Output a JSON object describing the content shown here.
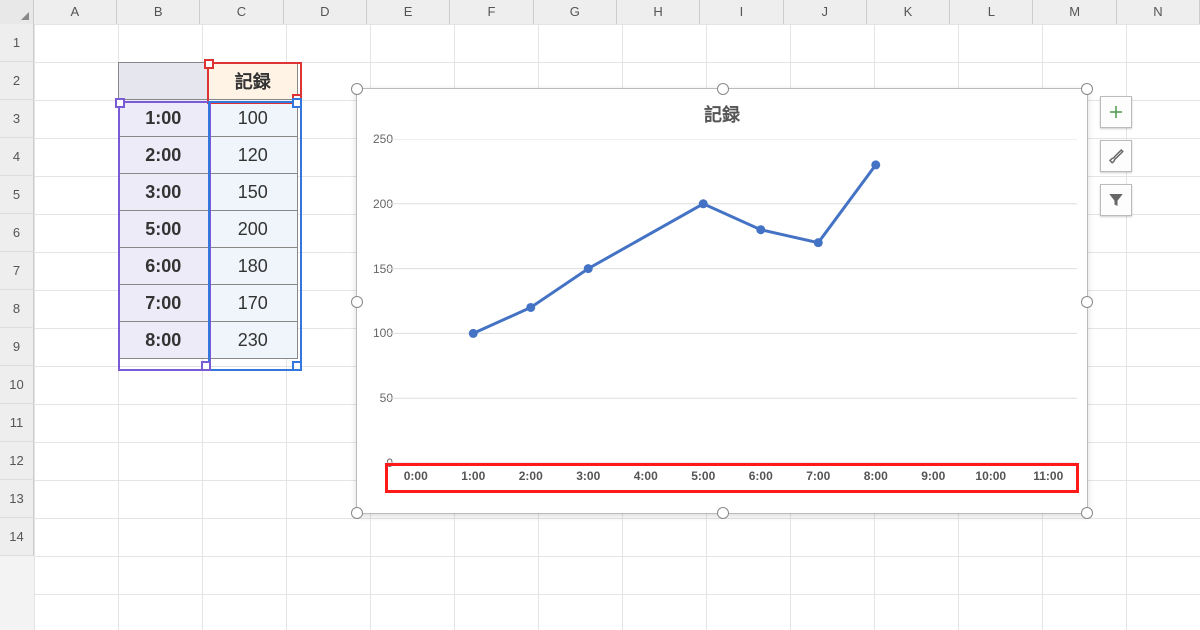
{
  "columns": [
    "A",
    "B",
    "C",
    "D",
    "E",
    "F",
    "G",
    "H",
    "I",
    "J",
    "K",
    "L",
    "M",
    "N"
  ],
  "rows": [
    "1",
    "2",
    "3",
    "4",
    "5",
    "6",
    "7",
    "8",
    "9",
    "10",
    "11",
    "12",
    "13",
    "14"
  ],
  "table": {
    "header_empty": "",
    "header_value": "記録",
    "rows": [
      {
        "time": "1:00",
        "value": "100"
      },
      {
        "time": "2:00",
        "value": "120"
      },
      {
        "time": "3:00",
        "value": "150"
      },
      {
        "time": "5:00",
        "value": "200"
      },
      {
        "time": "6:00",
        "value": "180"
      },
      {
        "time": "7:00",
        "value": "170"
      },
      {
        "time": "8:00",
        "value": "230"
      }
    ]
  },
  "chart": {
    "title": "記録",
    "x_ticks": [
      "0:00",
      "1:00",
      "2:00",
      "3:00",
      "4:00",
      "5:00",
      "6:00",
      "7:00",
      "8:00",
      "9:00",
      "10:00",
      "11:00"
    ],
    "y_ticks": [
      0,
      50,
      100,
      150,
      200,
      250
    ]
  },
  "chart_data": {
    "type": "line",
    "title": "記録",
    "xlabel": "",
    "ylabel": "",
    "ylim": [
      0,
      250
    ],
    "x": [
      1,
      2,
      3,
      5,
      6,
      7,
      8
    ],
    "values": [
      100,
      120,
      150,
      200,
      180,
      170,
      230
    ],
    "x_tick_labels": [
      "0:00",
      "1:00",
      "2:00",
      "3:00",
      "4:00",
      "5:00",
      "6:00",
      "7:00",
      "8:00",
      "9:00",
      "10:00",
      "11:00"
    ]
  },
  "side_tools": {
    "add": "plus-icon",
    "style": "brush-icon",
    "filter": "funnel-icon"
  }
}
